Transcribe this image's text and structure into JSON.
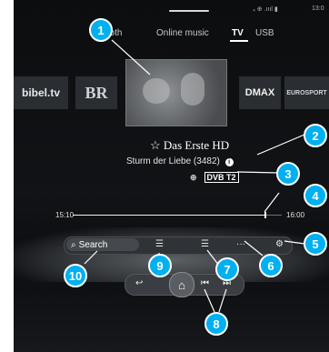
{
  "status": {
    "time": "13:0",
    "signal": "₄ ⊕ .ıııl ▮"
  },
  "tabs": [
    "ooth",
    "Online music",
    "TV",
    "USB"
  ],
  "channels": [
    "bibel.tv",
    "BR",
    "DMAX",
    "EUROSPORT"
  ],
  "program": {
    "title": "Das Erste HD",
    "show": "Sturm der Liebe (3482)",
    "dvb": "DVB T2"
  },
  "progress": {
    "start": "15:10",
    "end": "16:00",
    "fraction": 0.92
  },
  "toolbar": {
    "search_label": "Search"
  },
  "callouts": [
    "1",
    "2",
    "3",
    "4",
    "5",
    "6",
    "7",
    "8",
    "9",
    "10"
  ],
  "colors": {
    "callout": "#00b0f0",
    "background": "#121316"
  }
}
